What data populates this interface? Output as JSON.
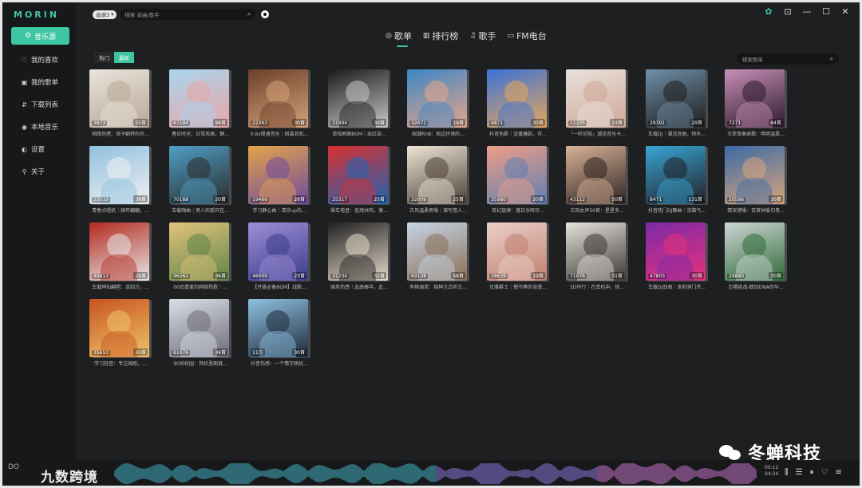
{
  "app": {
    "logo": "MORIN"
  },
  "sidebar": {
    "source_button": "音乐源",
    "items": [
      {
        "label": "我的喜欢",
        "icon": "heart-icon"
      },
      {
        "label": "我的歌单",
        "icon": "playlist-icon"
      },
      {
        "label": "下载列表",
        "icon": "download-icon"
      },
      {
        "label": "本地音乐",
        "icon": "local-music-icon"
      },
      {
        "label": "设置",
        "icon": "settings-toggle-icon"
      },
      {
        "label": "关于",
        "icon": "location-icon"
      }
    ]
  },
  "topbar": {
    "source_select": "音源3",
    "search_placeholder": "搜索 单曲/歌手"
  },
  "tabs": [
    {
      "label": "歌单",
      "active": true
    },
    {
      "label": "排行榜",
      "active": false
    },
    {
      "label": "歌手",
      "active": false
    },
    {
      "label": "FM电台",
      "active": false
    }
  ],
  "filter": {
    "hot": "热门",
    "new": "最新",
    "active": "new"
  },
  "playlist_search": {
    "placeholder": "搜索歌单"
  },
  "playlists": [
    {
      "plays": "3873",
      "count": "25首",
      "title": "网络伤感：孩子翻转的外...",
      "colors": [
        "#e9e4dc",
        "#b9a796"
      ]
    },
    {
      "plays": "67184",
      "count": "99首",
      "title": "春日时光：日常风格，静...",
      "colors": [
        "#a9d5ef",
        "#e9a6a6"
      ]
    },
    {
      "plays": "22363",
      "count": "30首",
      "title": "0.8x慢速音乐｜假装耳机...",
      "colors": [
        "#6b3f2a",
        "#d7a27a"
      ]
    },
    {
      "plays": "31904",
      "count": "30首",
      "title": "游戏刷图BGM｜血红染...",
      "colors": [
        "#1a1a1c",
        "#c7c7c7"
      ]
    },
    {
      "plays": "32471",
      "count": "19首",
      "title": "国潮RnB：周边环境的...",
      "colors": [
        "#3b86c6",
        "#e8a58a"
      ]
    },
    {
      "plays": "6871",
      "count": "30首",
      "title": "抖音热歌｜流量爆款，可...",
      "colors": [
        "#3a73d8",
        "#e7a65b"
      ]
    },
    {
      "plays": "11205",
      "count": "23首",
      "title": "「一秒沦陷」潮流音乐卡...",
      "colors": [
        "#e8e2dc",
        "#d0a796"
      ]
    },
    {
      "plays": "29391",
      "count": "29首",
      "title": "车载DJ｜潮流音曲，快乐...",
      "colors": [
        "#6f8fa7",
        "#1d1d1d"
      ]
    },
    {
      "plays": "7271",
      "count": "64首",
      "title": "王菲单曲表歌：明明温柔...",
      "colors": [
        "#c78fb8",
        "#2d1a2b"
      ]
    },
    {
      "plays": "23519",
      "count": "38首",
      "title": "青春点唱机｜国年翩翩，...",
      "colors": [
        "#8fc0de",
        "#f0f0f0"
      ]
    },
    {
      "plays": "70188",
      "count": "20首",
      "title": "车载嗨曲｜男人的孤只在...",
      "colors": [
        "#4fa0c7",
        "#2b2b2b"
      ]
    },
    {
      "plays": "19466",
      "count": "26首",
      "title": "学习静心曲｜清凉up的...",
      "colors": [
        "#e4a44b",
        "#6f4a9d"
      ]
    },
    {
      "plays": "25317",
      "count": "25首",
      "title": "飙车电音：低频共鸣，激...",
      "colors": [
        "#d9302e",
        "#2064b4"
      ]
    },
    {
      "plays": "32009",
      "count": "25首",
      "title": "古风温柔男嗓｜谱写悠人...",
      "colors": [
        "#efe6d6",
        "#4c4038"
      ]
    },
    {
      "plays": "35980",
      "count": "20首",
      "title": "奇幻旋律：落日余晖尽...",
      "colors": [
        "#ef9e86",
        "#5f7fb3"
      ]
    },
    {
      "plays": "43112",
      "count": "50首",
      "title": "古风女声50首：星星多...",
      "colors": [
        "#d9b396",
        "#2f2323"
      ]
    },
    {
      "plays": "8471",
      "count": "131首",
      "title": "抖音热门DJ舞曲｜洗脑气...",
      "colors": [
        "#37a7d4",
        "#231f28"
      ]
    },
    {
      "plays": "20586",
      "count": "30首",
      "title": "情深港嗓：百首钟爱句粤...",
      "colors": [
        "#3b6aa7",
        "#d8a57b"
      ]
    },
    {
      "plays": "89813",
      "count": "28首",
      "title": "车载神仙翻唱：走四方，...",
      "colors": [
        "#b32a1f",
        "#e6e6e6"
      ]
    },
    {
      "plays": "96262",
      "count": "36首",
      "title": "00后喜爱的网络热歌｜...",
      "colors": [
        "#e3c37d",
        "#5e8447"
      ]
    },
    {
      "plays": "46009",
      "count": "23首",
      "title": "【开盘必备BGM】战歌...",
      "colors": [
        "#9f8ed8",
        "#3a3d88"
      ]
    },
    {
      "plays": "31234",
      "count": "32首",
      "title": "国风伤感｜此曲泰华，此...",
      "colors": [
        "#202020",
        "#e4d9c9"
      ]
    },
    {
      "plays": "69138",
      "count": "58首",
      "title": "有格调单：接种方式听古...",
      "colors": [
        "#c6d5e5",
        "#8b6f58"
      ]
    },
    {
      "plays": "38639",
      "count": "19首",
      "title": "优雅爵士｜慢节奏的浪漫...",
      "colors": [
        "#ecd0c9",
        "#c0806e"
      ]
    },
    {
      "plays": "71076",
      "count": "31首",
      "title": "3D环行｜在耳机中，体...",
      "colors": [
        "#e6e3de",
        "#3b3734"
      ]
    },
    {
      "plays": "47803",
      "count": "30首",
      "title": "车载DJ劲曲｜发射洞门开...",
      "colors": [
        "#7a2aa8",
        "#e7327a"
      ]
    },
    {
      "plays": "29880",
      "count": "30首",
      "title": "忍唱挑战-撼动DNA的华...",
      "colors": [
        "#cfd5d4",
        "#2e6b3a"
      ]
    },
    {
      "plays": "35653",
      "count": "20首",
      "title": "学习轻音：专注国跑，...",
      "colors": [
        "#c7541e",
        "#f0c36b"
      ]
    },
    {
      "plays": "81076",
      "count": "34首",
      "title": "90后校园：耳机里面挑...",
      "colors": [
        "#d9dfe7",
        "#6e6b7a"
      ]
    },
    {
      "plays": "11万",
      "count": "30首",
      "title": "抖音伤感：一个情字困扰...",
      "colors": [
        "#8fc2e3",
        "#1f2a3a"
      ]
    }
  ],
  "watermark": {
    "text": "冬蝉科技",
    "icon": "wechat-icon"
  },
  "player": {
    "logo_text": "DO",
    "overlay_text": "九数跨境",
    "current_time": "00:12",
    "total_time": "04:24"
  }
}
